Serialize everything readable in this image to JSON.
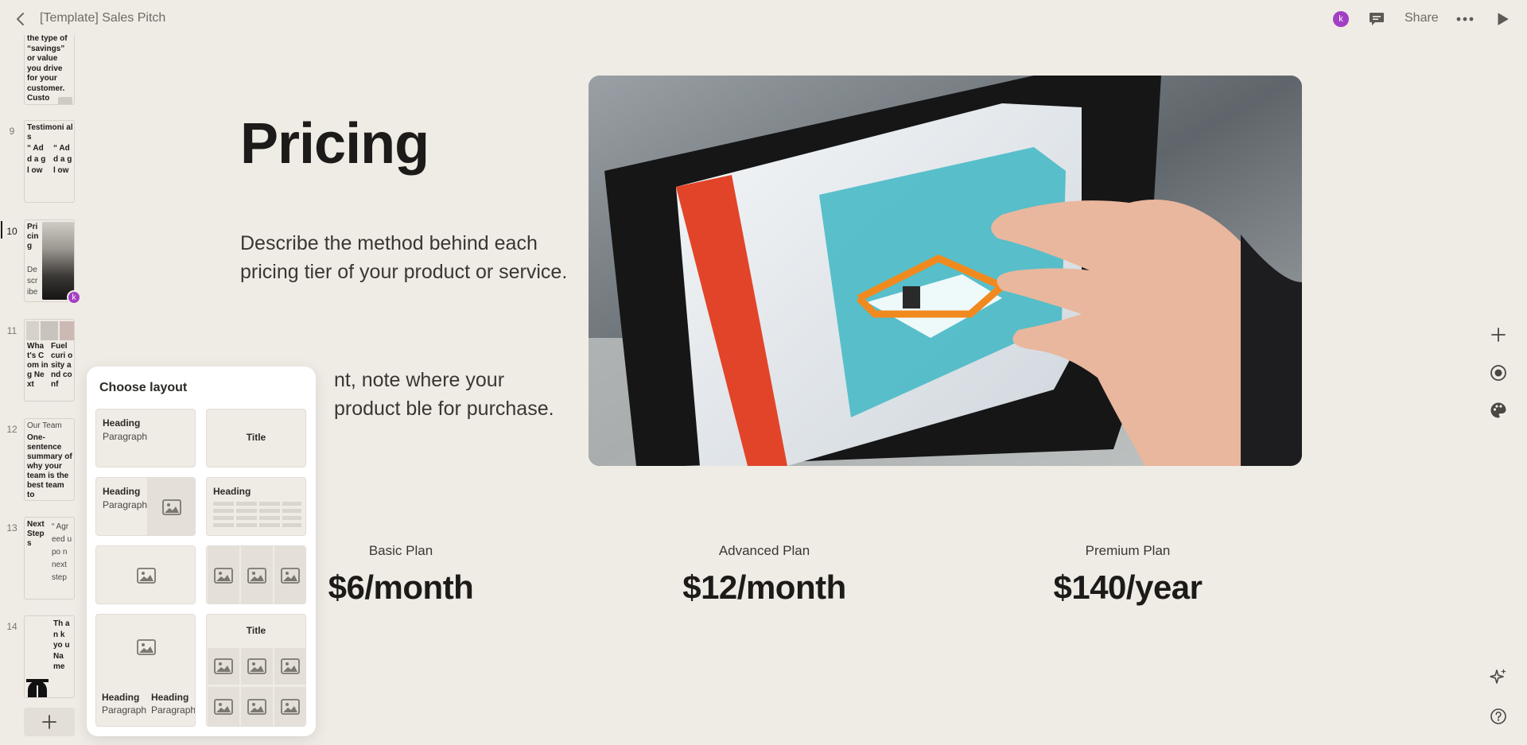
{
  "topbar": {
    "title": "[Template] Sales Pitch",
    "avatar_initial": "k",
    "share_label": "Share",
    "accent_color": "#a23fc4"
  },
  "thumbnails": {
    "partial_top": [
      "the type of",
      "“savings”",
      "or value",
      "you drive",
      "for your",
      "customer.",
      "Custo"
    ],
    "slide9": {
      "number": "9",
      "title": "Testimoni als",
      "col1": "“ Add a gl ow",
      "col2": "“ Ad d a gl ow"
    },
    "slide10": {
      "number": "10",
      "title": "Pri cin g",
      "body": "De scr ibe",
      "avatar_initial": "k"
    },
    "slide11": {
      "number": "11",
      "col1": "Wha t's Com ing Next",
      "col2": "Fuel curi osity and conf"
    },
    "slide12": {
      "number": "12",
      "label": "Our Team",
      "body": "One-sentence summary of why your team is the best team to"
    },
    "slide13": {
      "number": "13",
      "title": "Next Step s",
      "body": "“ Agr eed upo n next step"
    },
    "slide14": {
      "number": "14",
      "body": "Th an k yo u Na me"
    }
  },
  "slide": {
    "title": "Pricing",
    "para1": "Describe the method behind each pricing tier of your product or service.",
    "para2": "nt, note where your product ble for purchase.",
    "plans": [
      {
        "name": "Basic Plan",
        "price": "$6/month"
      },
      {
        "name": "Advanced Plan",
        "price": "$12/month"
      },
      {
        "name": "Premium Plan",
        "price": "$140/year"
      }
    ]
  },
  "layout_picker": {
    "title": "Choose layout",
    "heading": "Heading",
    "paragraph": "Paragraph",
    "title_label": "Title"
  },
  "icons": [
    "back-icon",
    "comment-icon",
    "more-icon",
    "play-icon",
    "add-icon",
    "record-icon",
    "palette-icon",
    "sparkle-icon",
    "help-icon",
    "image-icon",
    "plus-icon"
  ]
}
